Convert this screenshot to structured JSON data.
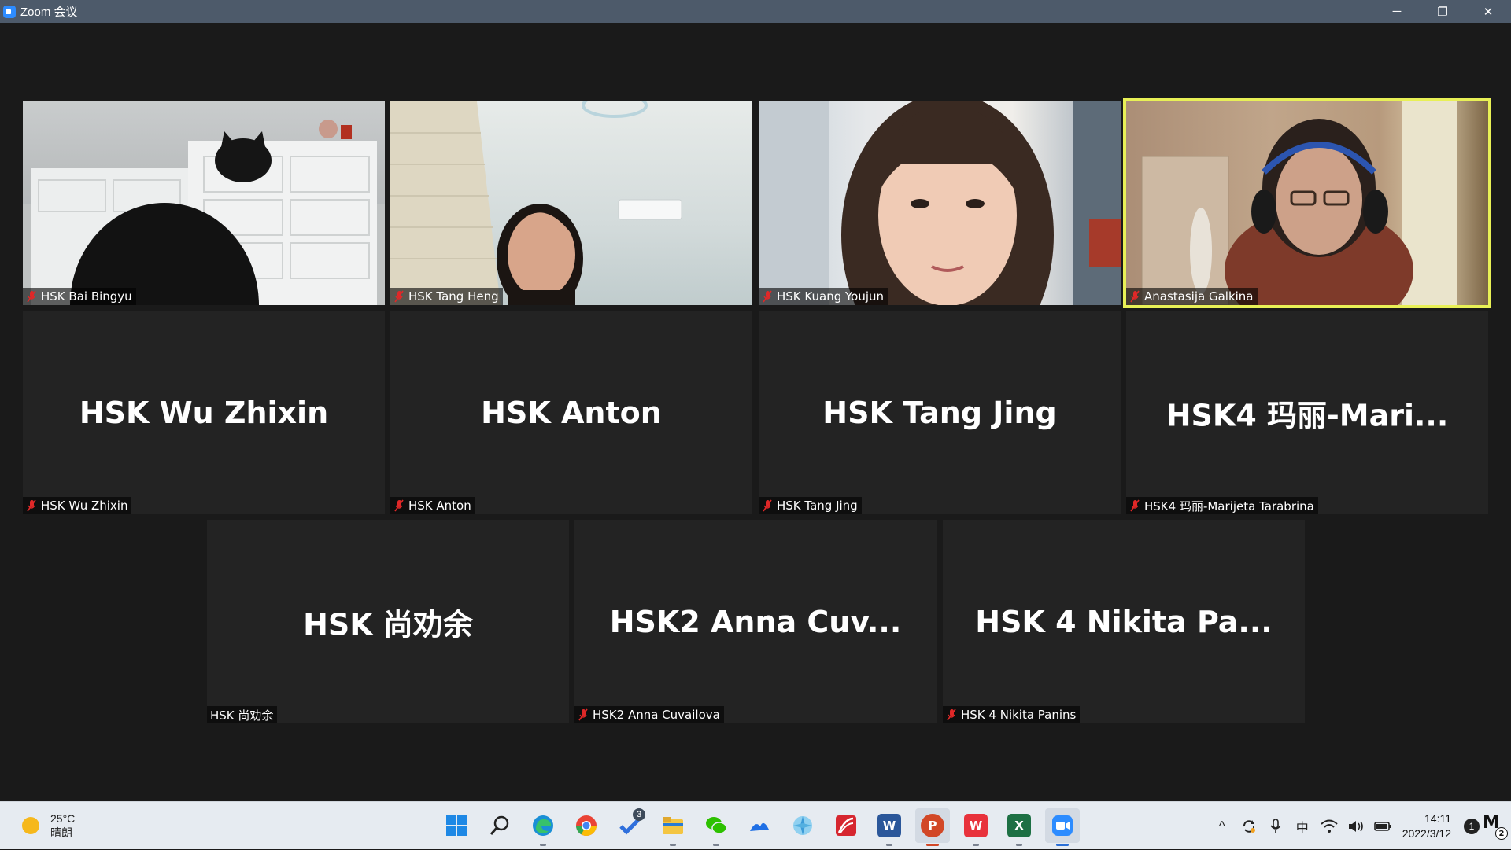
{
  "window": {
    "title": "Zoom 会议",
    "minimize_glyph": "─",
    "restore_glyph": "❐",
    "close_glyph": "✕"
  },
  "tiles": [
    {
      "name": "HSK Bai Bingyu",
      "video": true,
      "muted": true,
      "active": false
    },
    {
      "name": "HSK Tang Heng",
      "video": true,
      "muted": true,
      "active": false
    },
    {
      "name": "HSK Kuang Youjun",
      "video": true,
      "muted": true,
      "active": false
    },
    {
      "name": "Anastasija Galkina",
      "video": true,
      "muted": true,
      "active": true
    },
    {
      "big_name": "HSK Wu Zhixin",
      "name": "HSK Wu Zhixin",
      "video": false,
      "muted": true
    },
    {
      "big_name": "HSK Anton",
      "name": "HSK Anton",
      "video": false,
      "muted": true
    },
    {
      "big_name": "HSK Tang Jing",
      "name": "HSK Tang Jing",
      "video": false,
      "muted": true
    },
    {
      "big_name": "HSK4 玛丽-Mari...",
      "name": "HSK4 玛丽-Marijeta Tarabrina",
      "video": false,
      "muted": true
    },
    {
      "big_name": "HSK 尚劝余",
      "name": "HSK 尚劝余",
      "video": false,
      "muted": false
    },
    {
      "big_name": "HSK2 Anna Cuv...",
      "name": "HSK2 Anna Cuvailova",
      "video": false,
      "muted": true
    },
    {
      "big_name": "HSK 4 Nikita Pa...",
      "name": "HSK 4 Nikita Panins",
      "video": false,
      "muted": true
    }
  ],
  "taskbar": {
    "weather": {
      "temp": "25°C",
      "condition": "晴朗"
    },
    "apps": [
      {
        "name": "start-icon",
        "label": "",
        "color": "#1e88e5"
      },
      {
        "name": "search-icon",
        "label": "",
        "color": "#e6ebf1"
      },
      {
        "name": "edge-icon",
        "label": "",
        "color": "#1a8fd6"
      },
      {
        "name": "chrome-icon",
        "label": "",
        "color": "#ea4335"
      },
      {
        "name": "todo-icon",
        "label": "",
        "color": "#2f6fdc",
        "badge": "3"
      },
      {
        "name": "file-explorer-icon",
        "label": "",
        "color": "#f4c542"
      },
      {
        "name": "wechat-icon",
        "label": "",
        "color": "#2dc100"
      },
      {
        "name": "feishu-icon",
        "label": "",
        "color": "#1f6fe5"
      },
      {
        "name": "pinwheel-icon",
        "label": "",
        "color": "#3c9bd8"
      },
      {
        "name": "red-app-icon",
        "label": "",
        "color": "#d6262f"
      },
      {
        "name": "word-icon",
        "label": "W",
        "color": "#2b579a"
      },
      {
        "name": "powerpoint-icon",
        "label": "P",
        "color": "#d24726"
      },
      {
        "name": "wps-icon",
        "label": "W",
        "color": "#e8323c"
      },
      {
        "name": "excel-icon",
        "label": "X",
        "color": "#1d7044"
      },
      {
        "name": "zoom-icon",
        "label": "",
        "color": "#2d8cff"
      }
    ],
    "tray": {
      "ime": "中",
      "time": "14:11",
      "date": "2022/3/12",
      "notifications": "1",
      "corner_badge": "2"
    }
  }
}
